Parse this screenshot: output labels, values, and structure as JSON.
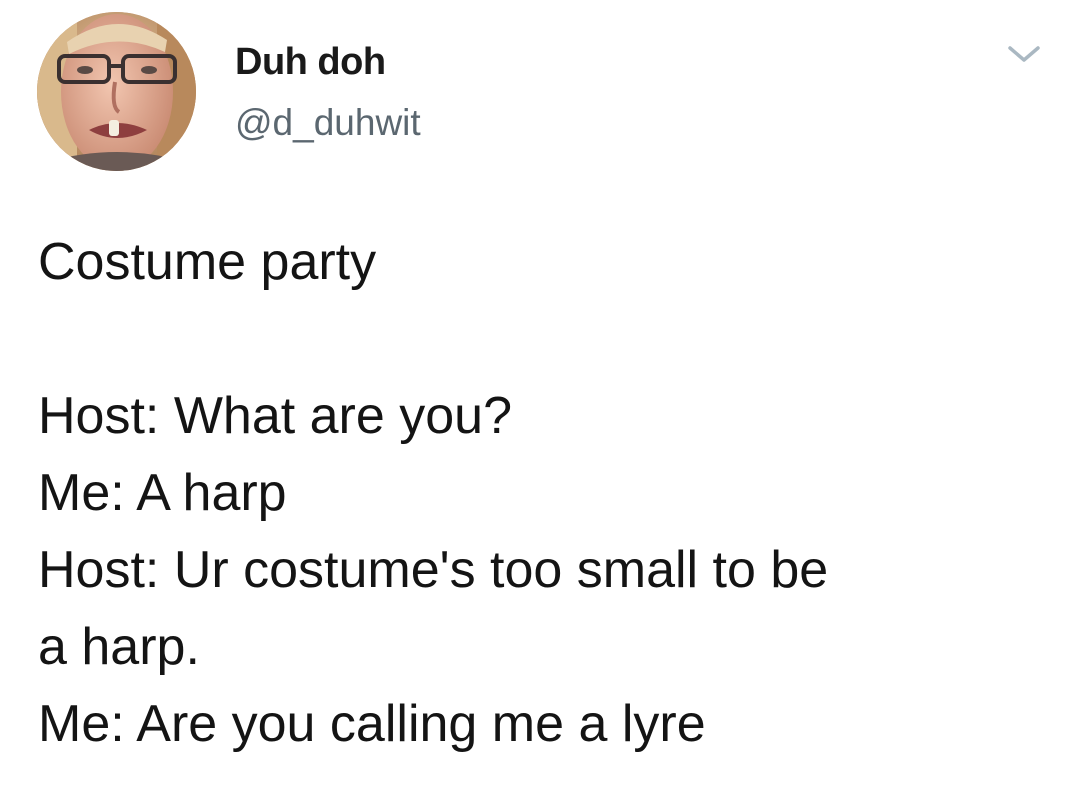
{
  "author": {
    "display_name": "Duh doh",
    "handle": "@d_duhwit"
  },
  "icons": {
    "avatar": "profile-photo",
    "menu": "chevron-down-icon"
  },
  "colors": {
    "text": "#141414",
    "handle": "#5b6770",
    "chevron": "#aab8c2",
    "background": "#ffffff"
  },
  "tweet": {
    "lines": [
      "Costume party",
      "",
      "Host: What are you?",
      "Me: A harp",
      "Host: Ur costume's too small to be",
      "a harp.",
      "Me: Are you calling me a lyre"
    ]
  }
}
